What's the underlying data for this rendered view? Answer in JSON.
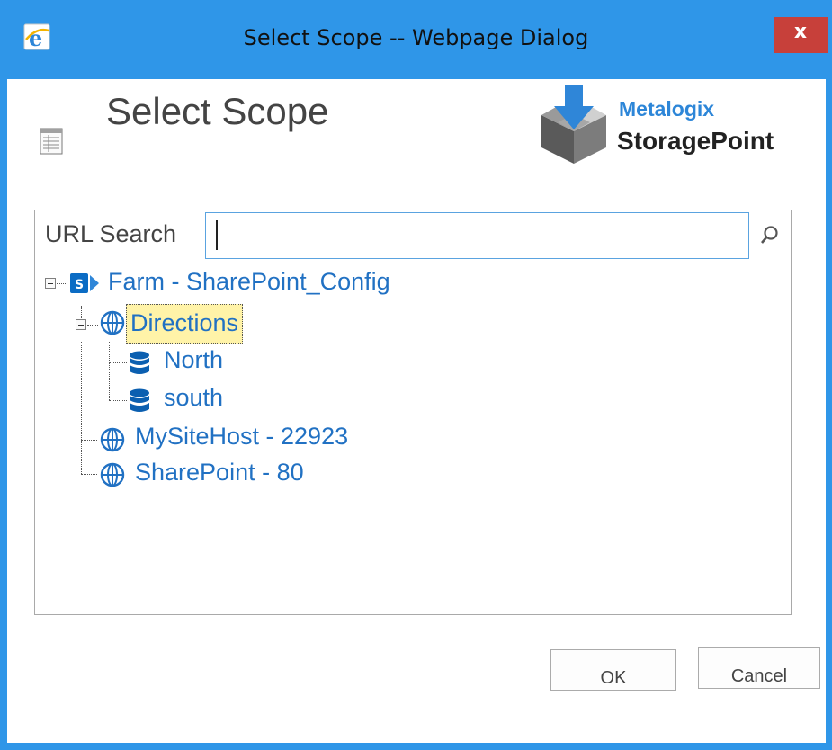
{
  "window": {
    "title": "Select Scope -- Webpage Dialog",
    "close_label": "x",
    "icon": "ie-icon"
  },
  "header": {
    "title": "Select Scope",
    "icon": "list-icon"
  },
  "logo": {
    "brand": "Metalogix",
    "product": "StoragePoint",
    "icon": "storagepoint-box-icon"
  },
  "search": {
    "label": "URL Search",
    "value": "",
    "placeholder": "",
    "icon": "search-icon"
  },
  "tree": {
    "farm": {
      "label": "Farm - SharePoint_Config",
      "icon": "sharepoint-icon"
    },
    "items": [
      {
        "label": "Directions",
        "icon": "globe-icon",
        "selected": true,
        "children": [
          {
            "label": "North",
            "icon": "database-icon"
          },
          {
            "label": "south",
            "icon": "database-icon"
          }
        ]
      },
      {
        "label": "MySiteHost - 22923",
        "icon": "globe-icon"
      },
      {
        "label": "SharePoint - 80",
        "icon": "globe-icon"
      }
    ]
  },
  "buttons": {
    "ok_label": "OK",
    "cancel_label": "Cancel"
  },
  "colors": {
    "titlebar": "#2f96e8",
    "close": "#c7403a",
    "link": "#2171c3",
    "selected_bg": "#fff3a8"
  }
}
